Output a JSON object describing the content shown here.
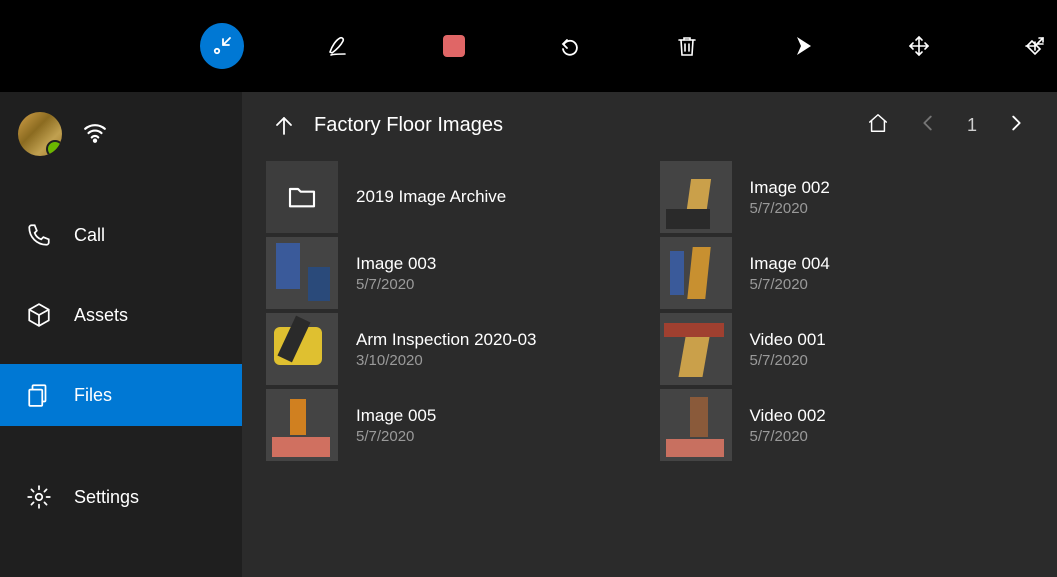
{
  "toolbar": {
    "icons": [
      "arrows-in",
      "ink-pen",
      "stop-record",
      "undo",
      "trash",
      "play-send",
      "move-arrows",
      "pin"
    ]
  },
  "sidebar": {
    "items": [
      {
        "icon": "phone",
        "label": "Call"
      },
      {
        "icon": "cube",
        "label": "Assets"
      },
      {
        "icon": "files",
        "label": "Files",
        "active": true
      },
      {
        "icon": "gear",
        "label": "Settings"
      }
    ]
  },
  "header": {
    "title": "Factory Floor Images",
    "page": "1"
  },
  "files": {
    "left": [
      {
        "kind": "folder",
        "name": "2019 Image Archive",
        "date": ""
      },
      {
        "kind": "image",
        "thumb": "th-a",
        "name": "Image 003",
        "date": "5/7/2020"
      },
      {
        "kind": "image",
        "thumb": "th-d",
        "name": "Arm Inspection 2020-03",
        "date": "3/10/2020"
      },
      {
        "kind": "image",
        "thumb": "th-f",
        "name": "Image 005",
        "date": "5/7/2020"
      }
    ],
    "right": [
      {
        "kind": "image",
        "thumb": "th-b",
        "name": "Image 002",
        "date": "5/7/2020"
      },
      {
        "kind": "image",
        "thumb": "th-c",
        "name": "Image 004",
        "date": "5/7/2020"
      },
      {
        "kind": "image",
        "thumb": "th-e",
        "name": "Video 001",
        "date": "5/7/2020"
      },
      {
        "kind": "image",
        "thumb": "th-g",
        "name": "Video 002",
        "date": "5/7/2020"
      }
    ]
  }
}
